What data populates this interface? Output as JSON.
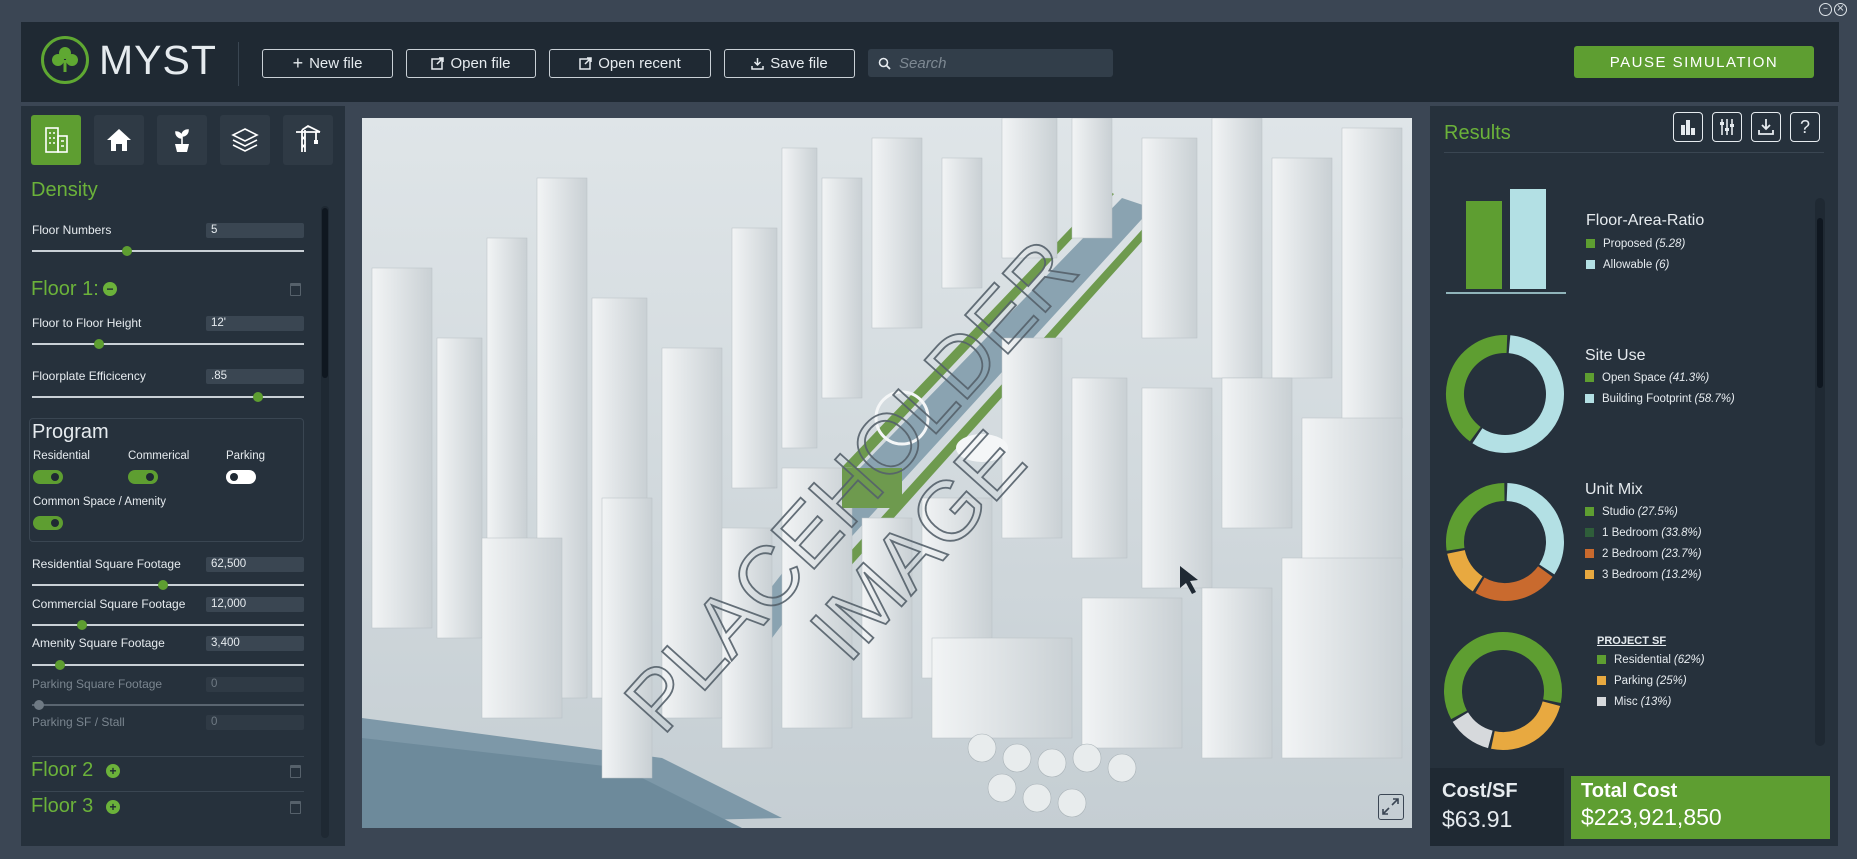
{
  "app": {
    "name": "MYST",
    "accent": "#5e9e31"
  },
  "toolbar": {
    "new_file": "New file",
    "open_file": "Open file",
    "open_recent": "Open recent",
    "save_file": "Save file",
    "search_placeholder": "Search",
    "pause": "PAUSE SIMULATION"
  },
  "left": {
    "tools": [
      "building-icon",
      "home-icon",
      "plant-icon",
      "layers-icon",
      "crane-icon"
    ],
    "density_title": "Density",
    "floor_numbers": {
      "label": "Floor Numbers",
      "value": "5"
    },
    "floor1": {
      "title": "Floor 1:",
      "floor_to_floor": {
        "label": "Floor to Floor Height",
        "value": "12'"
      },
      "efficiency": {
        "label": "Floorplate Efficicency",
        "value": ".85"
      }
    },
    "program": {
      "title": "Program",
      "residential": "Residential",
      "commercial": "Commerical",
      "parking": "Parking",
      "common": "Common Space / Amenity",
      "residential_on": true,
      "commercial_on": true,
      "parking_on": false,
      "common_on": true
    },
    "residential_sf": {
      "label": "Residential Square Footage",
      "value": "62,500"
    },
    "commercial_sf": {
      "label": "Commercial Square Footage",
      "value": "12,000"
    },
    "amenity_sf": {
      "label": "Amenity Square Footage",
      "value": "3,400"
    },
    "parking_sf": {
      "label": "Parking Square Footage",
      "value": "0"
    },
    "parking_stall": {
      "label": "Parking SF / Stall",
      "value": "0"
    },
    "floor2": "Floor 2",
    "floor3": "Floor 3"
  },
  "viewport": {
    "watermark_line1": "PLACEHOLDER",
    "watermark_line2": "IMAGE"
  },
  "results": {
    "title": "Results",
    "far": {
      "title": "Floor-Area-Ratio",
      "proposed_label": "Proposed",
      "proposed_value": "(5.28)",
      "allowable_label": "Allowable",
      "allowable_value": "(6)",
      "proposed": 5.28,
      "allowable": 6,
      "proposed_color": "#5e9e31",
      "allowable_color": "#b3e0e4"
    },
    "site_use": {
      "title": "Site Use",
      "items": [
        {
          "label": "Open Space",
          "pct_text": "(41.3%)",
          "value": 41.3,
          "color": "#5e9e31"
        },
        {
          "label": "Building Footprint",
          "pct_text": "(58.7%)",
          "value": 58.7,
          "color": "#b3e0e4"
        }
      ]
    },
    "unit_mix": {
      "title": "Unit Mix",
      "items": [
        {
          "label": "Studio",
          "pct_text": "(27.5%)",
          "value": 27.5,
          "color": "#5e9e31"
        },
        {
          "label": "1 Bedroom",
          "pct_text": "(33.8%)",
          "value": 33.8,
          "color": "#b3e0e4"
        },
        {
          "label": "2 Bedroom",
          "pct_text": "(23.7%)",
          "value": 23.7,
          "color": "#c96a2e"
        },
        {
          "label": "3 Bedroom",
          "pct_text": "(13.2%)",
          "value": 13.2,
          "color": "#e8a940"
        }
      ]
    },
    "project_sf": {
      "title": "PROJECT SF",
      "items": [
        {
          "label": "Residential",
          "pct_text": "(62%)",
          "value": 62,
          "color": "#5e9e31"
        },
        {
          "label": "Parking",
          "pct_text": "(25%)",
          "value": 25,
          "color": "#e8a940"
        },
        {
          "label": "Misc",
          "pct_text": "(13%)",
          "value": 13,
          "color": "#d6d9dc"
        }
      ]
    }
  },
  "costs": {
    "cost_sf_label": "Cost/SF",
    "cost_sf_value": "$63.91",
    "total_label": "Total Cost",
    "total_value": "$223,921,850"
  }
}
